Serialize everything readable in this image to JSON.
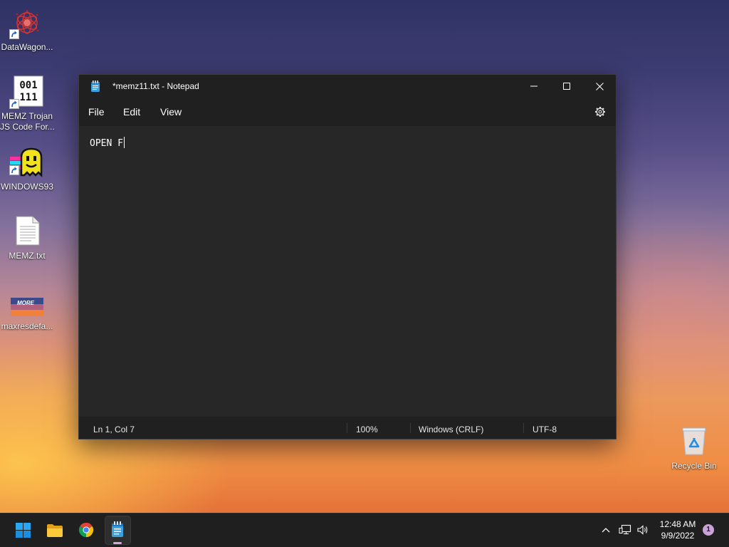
{
  "desktop": {
    "icons": [
      {
        "label": "DataWagon...",
        "icon": "datawagon-icon",
        "shortcut": true
      },
      {
        "label_lines": [
          "MEMZ Trojan",
          "JS Code For..."
        ],
        "icon": "binary-document-icon",
        "icon_glyphs": [
          "001",
          "111"
        ],
        "shortcut": true
      },
      {
        "label": "WINDOWS93",
        "icon": "windows93-smiley-icon",
        "shortcut": true
      },
      {
        "label": "MEMZ.txt",
        "icon": "text-file-icon",
        "shortcut": false
      },
      {
        "label": "maxresdefa...",
        "icon": "image-thumbnail-icon",
        "thumbnail_text": "MORE",
        "shortcut": false
      }
    ],
    "recycle_bin": {
      "label": "Recycle Bin",
      "icon": "recycle-bin-icon"
    }
  },
  "notepad": {
    "title": "*memz11.txt - Notepad",
    "icon": "notepad-icon",
    "menu": [
      {
        "label": "File"
      },
      {
        "label": "Edit"
      },
      {
        "label": "View"
      }
    ],
    "settings_icon": "gear-icon",
    "content": "OPEN F",
    "status_bar": {
      "position": "Ln 1, Col 7",
      "zoom": "100%",
      "line_ending": "Windows (CRLF)",
      "encoding": "UTF-8"
    }
  },
  "taskbar": {
    "apps": [
      {
        "icon": "windows-start-icon",
        "active": false
      },
      {
        "icon": "folder-icon",
        "active": false
      },
      {
        "icon": "chrome-icon",
        "active": false
      },
      {
        "icon": "notepad-icon",
        "active": true
      }
    ],
    "tray_icons": [
      "chevron-up-icon",
      "network-icon",
      "volume-icon"
    ],
    "clock": {
      "time": "12:48 AM",
      "date": "9/9/2022"
    },
    "notification_badge": "1"
  },
  "colors": {
    "window_chrome": "#202020",
    "editor_background": "#272727",
    "taskbar": "#1f1f1f",
    "notification_badge": "#c7a3d6",
    "active_indicator": "#d1a6d8"
  }
}
